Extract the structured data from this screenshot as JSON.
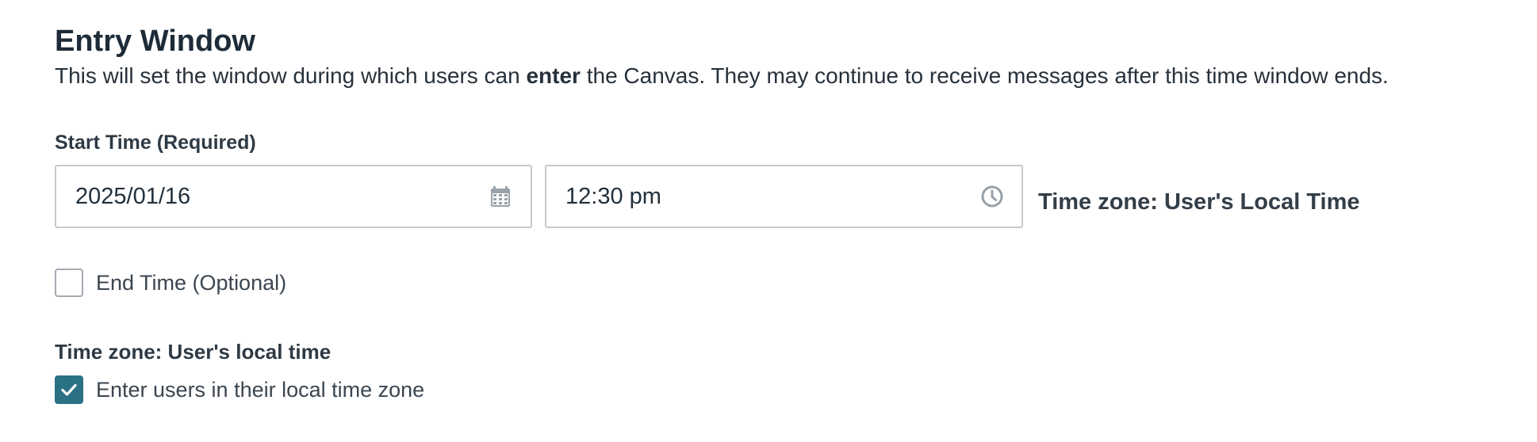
{
  "section": {
    "title": "Entry Window",
    "description_before": "This will set the window during which users can ",
    "description_bold": "enter",
    "description_after": " the Canvas. They may continue to receive messages after this time window ends."
  },
  "start_time": {
    "label": "Start Time (Required)",
    "date_value": "2025/01/16",
    "time_value": "12:30 pm",
    "date_icon": "calendar-icon",
    "time_icon": "clock-icon",
    "timezone_note": "Time zone: User's Local Time"
  },
  "end_time": {
    "checkbox_label": "End Time (Optional)",
    "checked": false
  },
  "timezone": {
    "label": "Time zone: User's local time",
    "checkbox_label": "Enter users in their local time zone",
    "checked": true
  },
  "colors": {
    "checkbox_checked": "#2b7186",
    "field_border": "#c5c9cd",
    "icon_gray": "#9aa1a8",
    "text_dark": "#1e2b38"
  }
}
